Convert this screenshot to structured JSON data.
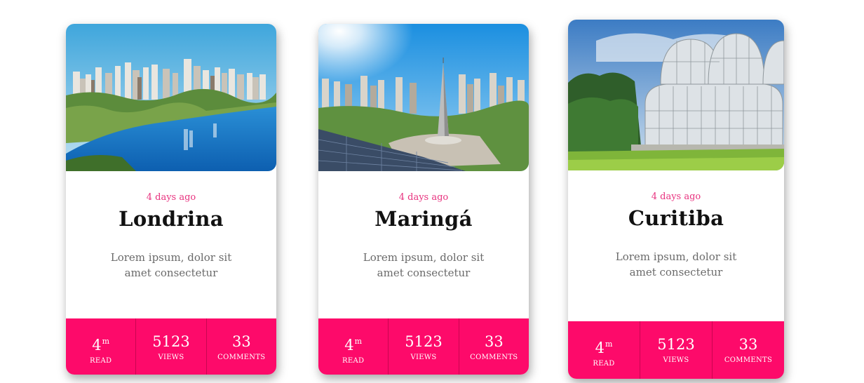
{
  "cards": [
    {
      "date": "4 days ago",
      "title": "Londrina",
      "description": "Lorem ipsum, dolor sit amet consectetur",
      "stats": [
        {
          "value": "4",
          "unit": "m",
          "label": "READ"
        },
        {
          "value": "5123",
          "unit": "",
          "label": "VIEWS"
        },
        {
          "value": "33",
          "unit": "",
          "label": "COMMENTS"
        }
      ]
    },
    {
      "date": "4 days ago",
      "title": "Maringá",
      "description": "Lorem ipsum, dolor sit amet consectetur",
      "stats": [
        {
          "value": "4",
          "unit": "m",
          "label": "READ"
        },
        {
          "value": "5123",
          "unit": "",
          "label": "VIEWS"
        },
        {
          "value": "33",
          "unit": "",
          "label": "COMMENTS"
        }
      ]
    },
    {
      "date": "4 days ago",
      "title": "Curitiba",
      "description": "Lorem ipsum, dolor sit amet consectetur",
      "stats": [
        {
          "value": "4",
          "unit": "m",
          "label": "READ"
        },
        {
          "value": "5123",
          "unit": "",
          "label": "VIEWS"
        },
        {
          "value": "33",
          "unit": "",
          "label": "COMMENTS"
        }
      ]
    }
  ],
  "colors": {
    "accent": "#fd0a6a",
    "date": "#e8337f",
    "title": "#111111",
    "description": "#6a6a6a"
  }
}
